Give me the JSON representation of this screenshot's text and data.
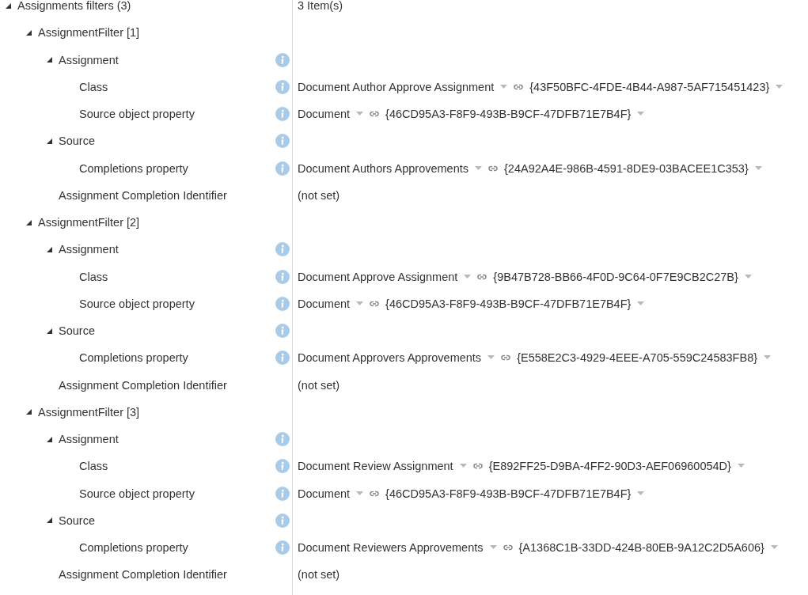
{
  "tree": {
    "label": "Assignments filters (3)",
    "expanded": true,
    "info": false,
    "value": {
      "kind": "text",
      "text": "3 Item(s)"
    },
    "children": [
      {
        "label": "AssignmentFilter [1]",
        "expanded": true,
        "info": false,
        "children": [
          {
            "label": "Assignment",
            "expanded": true,
            "info": true,
            "children": [
              {
                "label": "Class",
                "info": true,
                "value": {
                  "kind": "reference",
                  "text": "Document Author Approve Assignment",
                  "id": "{43F50BFC-4FDE-4B44-A987-5AF715451423}"
                }
              },
              {
                "label": "Source object property",
                "info": true,
                "value": {
                  "kind": "reference",
                  "text": "Document",
                  "id": "{46CD95A3-F8F9-493B-B9CF-47DFB71E7B4F}"
                }
              }
            ]
          },
          {
            "label": "Source",
            "expanded": true,
            "info": true,
            "children": [
              {
                "label": "Completions property",
                "info": true,
                "value": {
                  "kind": "reference",
                  "text": "Document Authors Approvements",
                  "id": "{24A92A4E-986B-4591-8DE9-03BACEE1C353}"
                }
              }
            ]
          },
          {
            "label": "Assignment Completion Identifier",
            "info": false,
            "value": {
              "kind": "text",
              "text": "(not set)"
            }
          }
        ]
      },
      {
        "label": "AssignmentFilter [2]",
        "expanded": true,
        "info": false,
        "children": [
          {
            "label": "Assignment",
            "expanded": true,
            "info": true,
            "children": [
              {
                "label": "Class",
                "info": true,
                "value": {
                  "kind": "reference",
                  "text": "Document Approve Assignment",
                  "id": "{9B47B728-BB66-4F0D-9C64-0F7E9CB2C27B}"
                }
              },
              {
                "label": "Source object property",
                "info": true,
                "value": {
                  "kind": "reference",
                  "text": "Document",
                  "id": "{46CD95A3-F8F9-493B-B9CF-47DFB71E7B4F}"
                }
              }
            ]
          },
          {
            "label": "Source",
            "expanded": true,
            "info": true,
            "children": [
              {
                "label": "Completions property",
                "info": true,
                "value": {
                  "kind": "reference",
                  "text": "Document Approvers Approvements",
                  "id": "{E558E2C3-4929-4EEE-A705-559C24583FB8}"
                }
              }
            ]
          },
          {
            "label": "Assignment Completion Identifier",
            "info": false,
            "value": {
              "kind": "text",
              "text": "(not set)"
            }
          }
        ]
      },
      {
        "label": "AssignmentFilter [3]",
        "expanded": true,
        "info": false,
        "children": [
          {
            "label": "Assignment",
            "expanded": true,
            "info": true,
            "children": [
              {
                "label": "Class",
                "info": true,
                "value": {
                  "kind": "reference",
                  "text": "Document Review Assignment",
                  "id": "{E892FF25-D9BA-4FF2-90D3-AEF06960054D}"
                }
              },
              {
                "label": "Source object property",
                "info": true,
                "value": {
                  "kind": "reference",
                  "text": "Document",
                  "id": "{46CD95A3-F8F9-493B-B9CF-47DFB71E7B4F}"
                }
              }
            ]
          },
          {
            "label": "Source",
            "expanded": true,
            "info": true,
            "children": [
              {
                "label": "Completions property",
                "info": true,
                "value": {
                  "kind": "reference",
                  "text": "Document Reviewers Approvements",
                  "id": "{A1368C1B-33DD-424B-80EB-9A12C2D5A606}"
                }
              }
            ]
          },
          {
            "label": "Assignment Completion Identifier",
            "info": false,
            "value": {
              "kind": "text",
              "text": "(not set)"
            }
          }
        ]
      }
    ]
  }
}
